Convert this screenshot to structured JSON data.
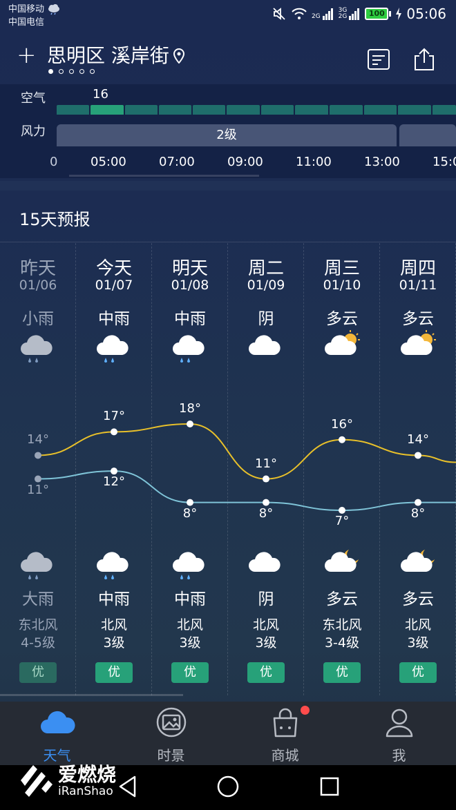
{
  "status_bar": {
    "carrier1": "中国移动",
    "carrier2": "中国电信",
    "net1": "2G",
    "net2a": "3G",
    "net2b": "2G",
    "battery": "100",
    "time": "05:06"
  },
  "header": {
    "location": "思明区 溪岸街",
    "page_dots": 5,
    "active_dot": 0
  },
  "hourly": {
    "air_label": "空气",
    "air_value": "16",
    "wind_label": "风力",
    "wind_value": "2级",
    "times": [
      "0",
      "05:00",
      "07:00",
      "09:00",
      "11:00",
      "13:00",
      "15:0"
    ]
  },
  "forecast": {
    "title": "15天预报",
    "days": [
      {
        "day": "昨天",
        "date": "01/06",
        "day_weather": "小雨",
        "day_icon": "rain-cloud-icon",
        "high": "14°",
        "low": "11°",
        "night_weather": "大雨",
        "night_icon": "rain-cloud-icon",
        "wind_dir": "东北风",
        "wind_level": "4-5级",
        "aqi": "优",
        "past": true
      },
      {
        "day": "今天",
        "date": "01/07",
        "day_weather": "中雨",
        "day_icon": "rain-cloud-icon",
        "high": "17°",
        "low": "12°",
        "night_weather": "中雨",
        "night_icon": "rain-cloud-icon",
        "wind_dir": "北风",
        "wind_level": "3级",
        "aqi": "优",
        "past": false
      },
      {
        "day": "明天",
        "date": "01/08",
        "day_weather": "中雨",
        "day_icon": "rain-cloud-icon",
        "high": "18°",
        "low": "8°",
        "night_weather": "中雨",
        "night_icon": "rain-cloud-icon",
        "wind_dir": "北风",
        "wind_level": "3级",
        "aqi": "优",
        "past": false
      },
      {
        "day": "周二",
        "date": "01/09",
        "day_weather": "阴",
        "day_icon": "cloud-icon",
        "high": "11°",
        "low": "8°",
        "night_weather": "阴",
        "night_icon": "cloud-icon",
        "wind_dir": "北风",
        "wind_level": "3级",
        "aqi": "优",
        "past": false
      },
      {
        "day": "周三",
        "date": "01/10",
        "day_weather": "多云",
        "day_icon": "sun-cloud-icon",
        "high": "16°",
        "low": "7°",
        "night_weather": "多云",
        "night_icon": "moon-cloud-icon",
        "wind_dir": "东北风",
        "wind_level": "3-4级",
        "aqi": "优",
        "past": false
      },
      {
        "day": "周四",
        "date": "01/11",
        "day_weather": "多云",
        "day_icon": "sun-cloud-icon",
        "high": "14°",
        "low": "8°",
        "night_weather": "多云",
        "night_icon": "moon-cloud-icon",
        "wind_dir": "北风",
        "wind_level": "3级",
        "aqi": "优",
        "past": false
      }
    ]
  },
  "tabs": [
    {
      "label": "天气",
      "icon": "cloud-icon",
      "active": true
    },
    {
      "label": "时景",
      "icon": "photo-icon",
      "active": false
    },
    {
      "label": "商城",
      "icon": "shopping-bag-icon",
      "active": false
    },
    {
      "label": "我",
      "icon": "user-icon",
      "active": false
    }
  ],
  "watermark": {
    "cn": "爱燃烧",
    "en": "iRanShao"
  },
  "colors": {
    "high_line": "#e8c02a",
    "low_line": "#7fc4d8",
    "aqi_good": "#27a179",
    "active_tab": "#3b8ff2",
    "badge": "#ff4c4c"
  }
}
